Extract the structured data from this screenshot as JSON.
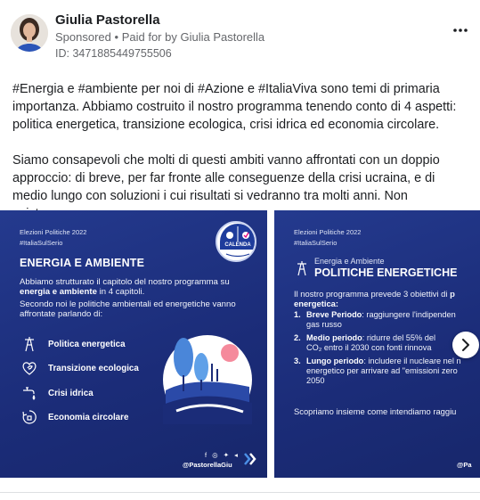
{
  "post": {
    "author": "Giulia Pastorella",
    "sponsored_label": "Sponsored",
    "separator": "•",
    "paid_for_prefix": "Paid for by",
    "paid_for_name": "Giulia Pastorella",
    "id_line": "ID: 3471885449755506",
    "paragraph1": "#Energia e #ambiente per noi di #Azione e #ItaliaViva sono temi di primaria importanza. Abbiamo costruito il nostro programma tenendo conto di 4 aspetti: politica energetica, transizione ecologica, crisi idrica ed economia circolare.",
    "paragraph2": "Siamo consapevoli che molti di questi ambiti vanno affrontati con un doppio approccio: di breve, per far fronte alle conseguenze della crisi ucraina, e di medio lungo con soluzioni i cui risultati si vedranno tra molti anni. Non esistono…"
  },
  "slide1": {
    "meta1": "Elezioni Politiche 2022",
    "meta2": "#ItaliaSulSerio",
    "title": "ENERGIA E AMBIENTE",
    "para1_a": "Abbiamo strutturato il capitolo del nostro programma su ",
    "para1_b": "energia e ambiente",
    "para1_c": " in 4 capitoli.",
    "para2": "Secondo noi le politiche ambientali ed energetiche vanno affrontate parlando di:",
    "topics": [
      "Politica energetica",
      "Transizione ecologica",
      "Crisi idrica",
      "Economia circolare"
    ],
    "logo_text": "CALENDA",
    "logo_top_left": "AZIONE",
    "logo_top_right": "ITALIA VIVA",
    "handle": "@PastorellaGiu",
    "footer_social": "f ◎ ✦ ◂"
  },
  "slide2": {
    "meta1": "Elezioni Politiche 2022",
    "meta2": "#ItaliaSulSerio",
    "subtitle": "Energia e Ambiente",
    "title": "POLITICHE ENERGETICHE",
    "intro_line1_a": "Il nostro programma prevede 3 obiettivi di ",
    "intro_line1_b": "p",
    "intro_line2": "energetica:",
    "items": [
      {
        "num": "1.",
        "label": "Breve Periodo",
        "rest1": ": raggiungere l'indipenden",
        "rest2": "gas russo"
      },
      {
        "num": "2.",
        "label": "Medio periodo",
        "rest1": ": ridurre del 55% del",
        "rest2": "CO₂ entro il 2030 con fonti rinnova"
      },
      {
        "num": "3.",
        "label": "Lungo periodo",
        "rest1": ": includere il nucleare nel n",
        "rest2": "energetico per arrivare ad \"emissioni zero",
        "rest3": "2050"
      }
    ],
    "bottom": "Scopriamo insieme come intendiamo raggiu",
    "handle": "@Pa"
  },
  "colors": {
    "slide_bg": "#1f3183",
    "accent_blue": "#3a7bd5",
    "text_secondary": "#65676b"
  },
  "icons": {
    "more": "more-horizontal-icon",
    "next": "chevron-right-icon"
  }
}
